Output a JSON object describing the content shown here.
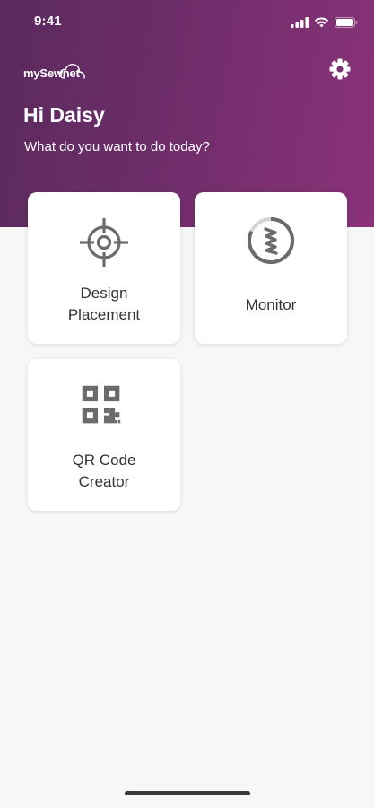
{
  "status_bar": {
    "time": "9:41",
    "icons": [
      "signal-icon",
      "wifi-icon",
      "battery-icon"
    ]
  },
  "header": {
    "logo_text": "mySewnet",
    "settings_icon": "gear-icon",
    "greeting": "Hi Daisy",
    "subtitle": "What do you want to do today?"
  },
  "cards": [
    {
      "icon": "crosshair-icon",
      "label_line1": "Design",
      "label_line2": "Placement"
    },
    {
      "icon": "monitor-icon",
      "label": "Monitor"
    },
    {
      "icon": "qr-code-icon",
      "label_line1": "QR Code",
      "label_line2": "Creator"
    }
  ],
  "colors": {
    "brand_gradient_start": "#5a2a5e",
    "brand_gradient_end": "#8a3279",
    "background": "#f7f7f7",
    "card": "#ffffff",
    "icon": "#6b6b6b",
    "text": "#333333"
  }
}
